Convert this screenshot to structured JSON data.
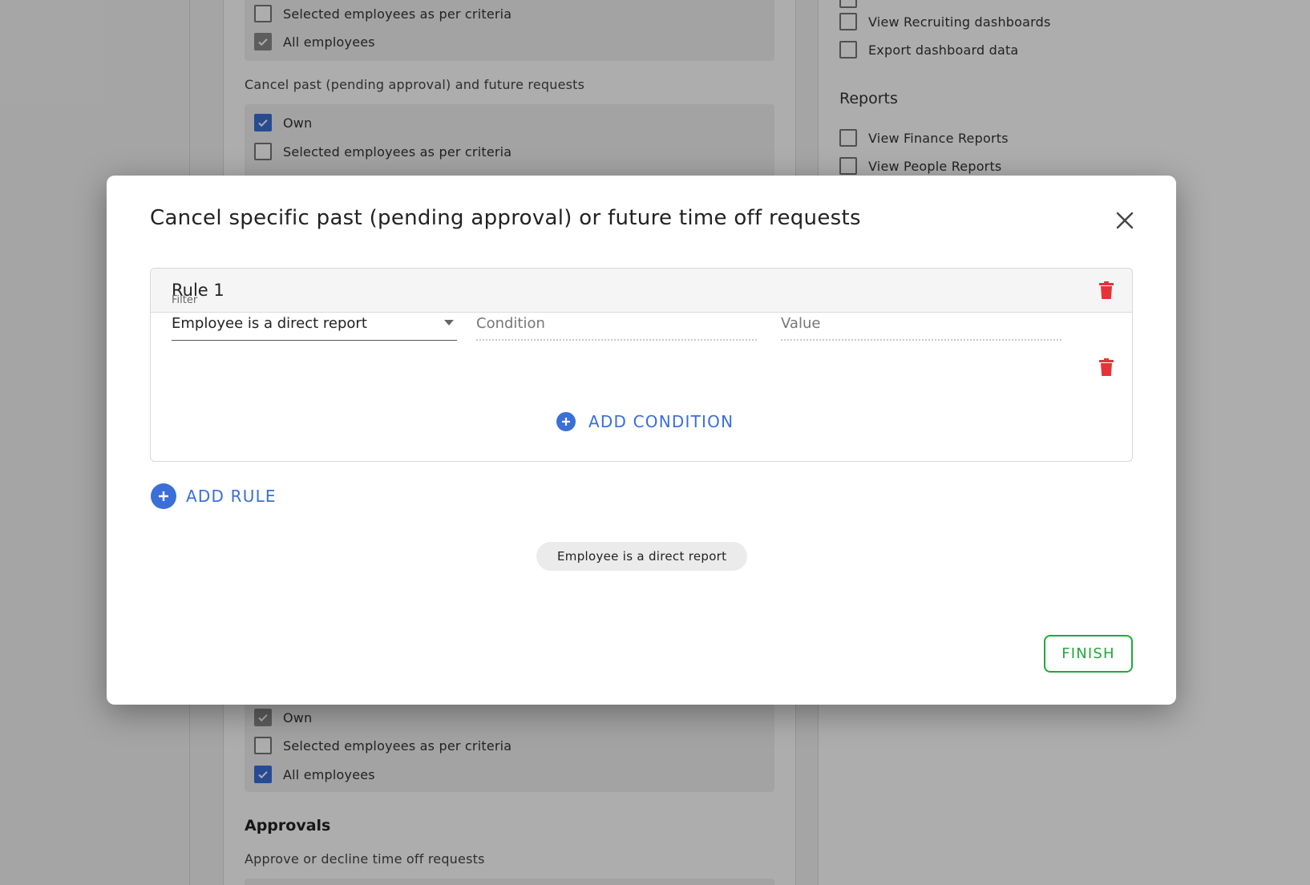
{
  "background": {
    "center_column": {
      "top_box": {
        "items": [
          {
            "label": "Selected employees as per criteria",
            "checked": false
          },
          {
            "label": "All employees",
            "checked": true
          }
        ]
      },
      "cancel_section_label": "Cancel past (pending approval) and future requests",
      "cancel_box": {
        "items": [
          {
            "label": "Own",
            "checked": true
          },
          {
            "label": "Selected employees as per criteria",
            "checked": false
          }
        ]
      },
      "bottom_box": {
        "items": [
          {
            "label": "Own",
            "checked": true
          },
          {
            "label": "Selected employees as per criteria",
            "checked": false
          },
          {
            "label": "All employees",
            "checked": true
          }
        ]
      },
      "approvals_heading": "Approvals",
      "approvals_label": "Approve or decline time off requests"
    },
    "right_column": {
      "dashboard_items": [
        {
          "label": "View Recruiting dashboards",
          "checked": false
        },
        {
          "label": "Export dashboard data",
          "checked": false
        }
      ],
      "reports_heading": "Reports",
      "report_items": [
        {
          "label": "View Finance Reports",
          "checked": false
        },
        {
          "label": "View People Reports",
          "checked": false
        }
      ]
    }
  },
  "modal": {
    "title": "Cancel specific past (pending approval) or future time off requests",
    "close_icon": "close-icon",
    "rule": {
      "title": "Rule 1",
      "filter": {
        "label": "Filter",
        "value": "Employee is a direct report"
      },
      "condition": {
        "placeholder": "Condition",
        "value": ""
      },
      "value": {
        "placeholder": "Value",
        "value": ""
      },
      "add_condition_label": "ADD CONDITION"
    },
    "add_rule_label": "ADD RULE",
    "summary_chip": "Employee is a direct report",
    "finish_label": "FINISH"
  },
  "colors": {
    "accent": "#3a6fd8",
    "danger": "#e5333a",
    "success": "#22a83a"
  }
}
